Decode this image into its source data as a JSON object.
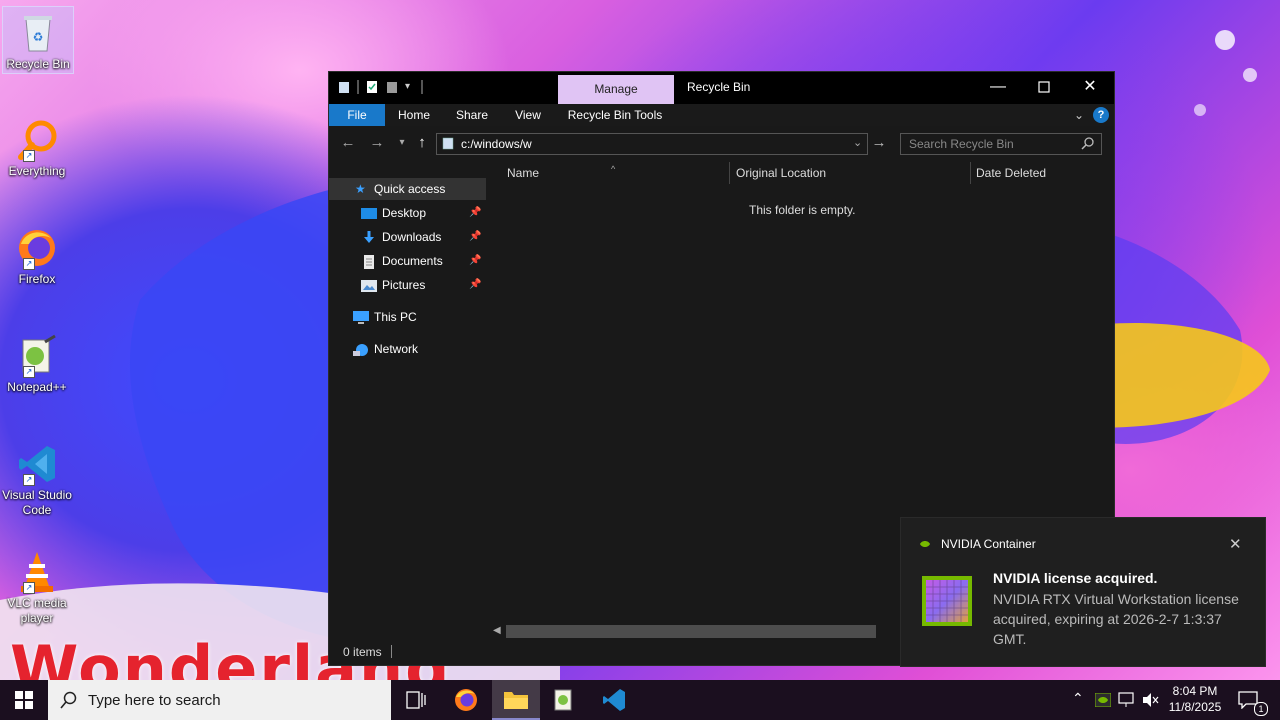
{
  "desktop": {
    "icons": [
      {
        "label": "Recycle Bin"
      },
      {
        "label": "Everything"
      },
      {
        "label": "Firefox"
      },
      {
        "label": "Notepad++"
      },
      {
        "label": "Visual Studio Code"
      },
      {
        "label": "VLC media player"
      }
    ],
    "wallpaper_text": "Wonderland"
  },
  "explorer": {
    "title": "Recycle Bin",
    "manage_tab": "Manage",
    "ribbon": {
      "file": "File",
      "home": "Home",
      "share": "Share",
      "view": "View",
      "tools": "Recycle Bin Tools"
    },
    "address": "c:/windows/w",
    "search_placeholder": "Search Recycle Bin",
    "nav": {
      "quick_access": "Quick access",
      "desktop": "Desktop",
      "downloads": "Downloads",
      "documents": "Documents",
      "pictures": "Pictures",
      "this_pc": "This PC",
      "network": "Network"
    },
    "columns": {
      "name": "Name",
      "original_location": "Original Location",
      "date_deleted": "Date Deleted"
    },
    "empty_message": "This folder is empty.",
    "status": "0 items"
  },
  "notification": {
    "app": "NVIDIA Container",
    "heading": "NVIDIA license acquired.",
    "body": "NVIDIA RTX Virtual Workstation license acquired, expiring at 2026-2-7 1:3:37 GMT."
  },
  "taskbar": {
    "search_placeholder": "Type here to search",
    "time": "8:04 PM",
    "date": "11/8/2025",
    "notification_count": "1"
  },
  "colors": {
    "accent": "#1979ca",
    "manage_tab": "#e0c4f4",
    "nvidia_green": "#76b900"
  }
}
